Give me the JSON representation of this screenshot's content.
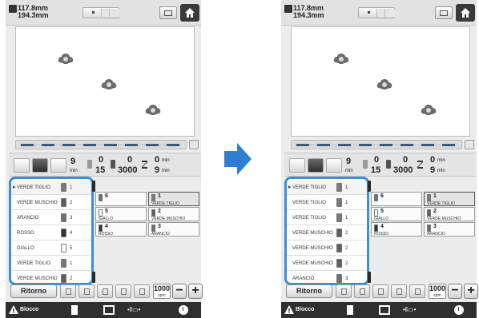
{
  "colors": {
    "accent": "#3b8ed7",
    "arrow": "#2e7fcf",
    "home_button": "#3a3a3a",
    "bottom_bar": "#2f2f2f"
  },
  "icons": {
    "size": "embroidery-size-icon",
    "layout": "layout-toggle-icon",
    "hoop": "hoop-view-icon",
    "home": "home-icon",
    "lock": "warning-lock-icon",
    "transition": "right-arrow-icon"
  },
  "left": {
    "size": {
      "width": "117.8mm",
      "height": "194.3mm"
    },
    "stats": {
      "stitch_min": "9",
      "stitch_min_unit": "min",
      "color_current": "0",
      "color_total": "15",
      "stitch_current": "0",
      "stitch_total": "3000",
      "time_current": "0",
      "time_unit_a": "min",
      "time_total": "9",
      "time_unit_b": "min"
    },
    "color_list": [
      {
        "name": "VERDE TIGLIO",
        "num": "1",
        "swatch": "#7a7a7a",
        "current": true
      },
      {
        "name": "VERDE MUSCHIO",
        "num": "2",
        "swatch": "#5e5e5e",
        "current": false
      },
      {
        "name": "ARANCIO",
        "num": "3",
        "swatch": "#6e6e6e",
        "current": false
      },
      {
        "name": "ROSSO",
        "num": "4",
        "swatch": "#333333",
        "current": false
      },
      {
        "name": "GIALLO",
        "num": "5",
        "swatch": "#ffffff",
        "current": false
      },
      {
        "name": "VERDE TIGLIO",
        "num": "1",
        "swatch": "#7a7a7a",
        "current": false
      },
      {
        "name": "VERDE MUSCHIO",
        "num": "2",
        "swatch": "#5e5e5e",
        "current": false
      }
    ],
    "grid": [
      {
        "num": "6",
        "name": "",
        "swatch": "#6e6e6e",
        "sel": false
      },
      {
        "num": "1",
        "name": "VERDE TIGLIO",
        "swatch": "#7a7a7a",
        "sel": true
      },
      {
        "num": "5",
        "name": "GIALLO",
        "swatch": "#ffffff",
        "sel": false
      },
      {
        "num": "2",
        "name": "VERDE MUSCHIO",
        "swatch": "#5e5e5e",
        "sel": false
      },
      {
        "num": "4",
        "name": "ROSSO",
        "swatch": "#333333",
        "sel": false
      },
      {
        "num": "3",
        "name": "ARANCIO",
        "swatch": "#6e6e6e",
        "sel": false
      }
    ],
    "return_label": "Ritorno",
    "speed_value": "1000",
    "speed_unit": "spm",
    "minus_label": "−",
    "plus_label": "+",
    "lock_label": "Blocco"
  },
  "right": {
    "size": {
      "width": "117.8mm",
      "height": "194.3mm"
    },
    "stats": {
      "stitch_min": "9",
      "stitch_min_unit": "min",
      "color_current": "0",
      "color_total": "15",
      "stitch_current": "0",
      "stitch_total": "3000",
      "time_current": "0",
      "time_unit_a": "min",
      "time_total": "9",
      "time_unit_b": "min"
    },
    "color_list": [
      {
        "name": "VERDE TIGLIO",
        "num": "1",
        "swatch": "#7a7a7a",
        "current": true
      },
      {
        "name": "VERDE TIGLIO",
        "num": "1",
        "swatch": "#7a7a7a",
        "current": false
      },
      {
        "name": "VERDE TIGLIO",
        "num": "1",
        "swatch": "#7a7a7a",
        "current": false
      },
      {
        "name": "VERDE MUSCHIO",
        "num": "2",
        "swatch": "#5e5e5e",
        "current": false
      },
      {
        "name": "VERDE MUSCHIO",
        "num": "2",
        "swatch": "#5e5e5e",
        "current": false
      },
      {
        "name": "VERDE MUSCHIO",
        "num": "2",
        "swatch": "#5e5e5e",
        "current": false
      },
      {
        "name": "ARANCIO",
        "num": "3",
        "swatch": "#6e6e6e",
        "current": false
      }
    ],
    "grid": [
      {
        "num": "6",
        "name": "",
        "swatch": "#6e6e6e",
        "sel": false
      },
      {
        "num": "1",
        "name": "VERDE TIGLIO",
        "swatch": "#7a7a7a",
        "sel": true
      },
      {
        "num": "5",
        "name": "GIALLO",
        "swatch": "#ffffff",
        "sel": false
      },
      {
        "num": "2",
        "name": "VERDE MUSCHIO",
        "swatch": "#5e5e5e",
        "sel": false
      },
      {
        "num": "4",
        "name": "ROSSO",
        "swatch": "#333333",
        "sel": false
      },
      {
        "num": "3",
        "name": "ARANCIO",
        "swatch": "#6e6e6e",
        "sel": false
      }
    ],
    "return_label": "Ritorno",
    "speed_value": "1000",
    "speed_unit": "spm",
    "minus_label": "−",
    "plus_label": "+",
    "lock_label": "Blocco"
  }
}
